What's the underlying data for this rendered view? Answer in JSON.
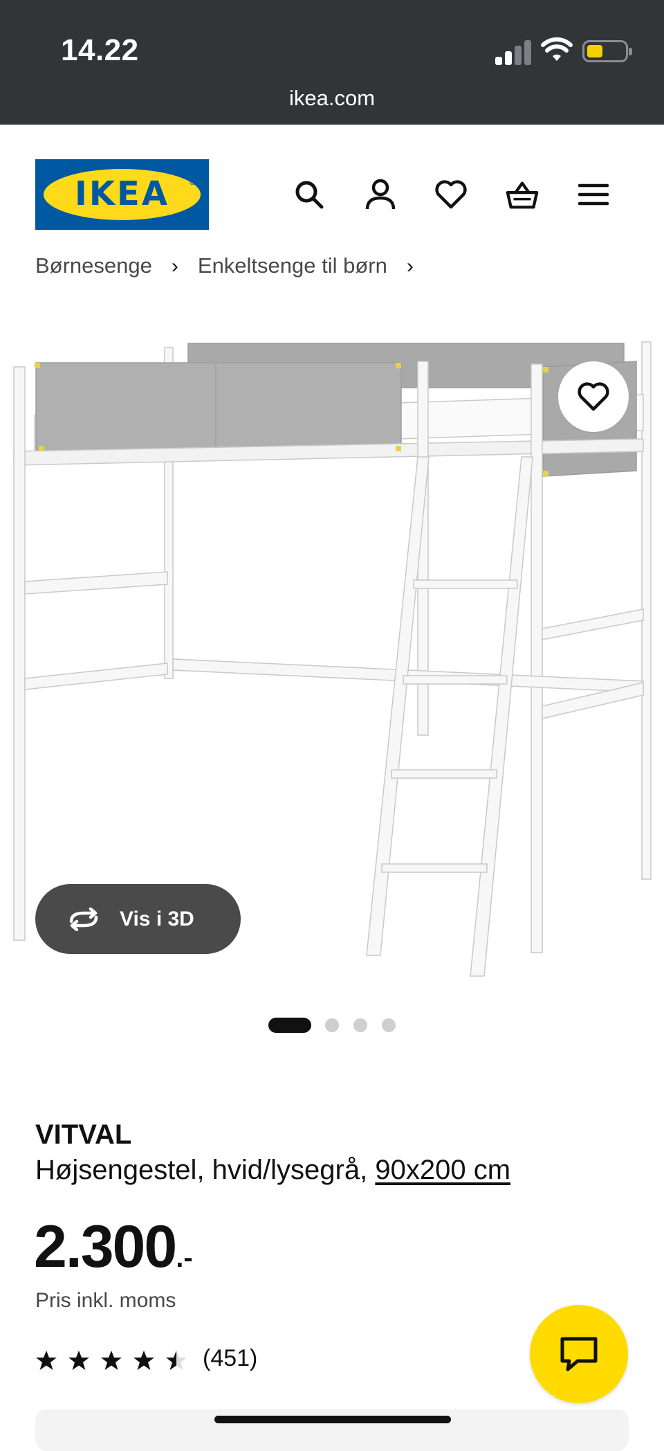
{
  "status_bar": {
    "time": "14.22",
    "url": "ikea.com"
  },
  "header": {
    "logo_text": "IKEA",
    "icons": [
      "search-icon",
      "account-icon",
      "heart-icon",
      "basket-icon",
      "menu-icon"
    ]
  },
  "breadcrumb": {
    "items": [
      "Børnesenge",
      "Enkeltsenge til børn"
    ]
  },
  "gallery": {
    "view_3d_label": "Vis i 3D",
    "image_count": 4,
    "active_image_index": 0
  },
  "product": {
    "name": "VITVAL",
    "description": "Højsengestel, hvid/lysegrå,",
    "size": "90x200 cm",
    "price": "2.300",
    "price_suffix": ".-",
    "vat_note": "Pris inkl. moms",
    "rating": 4.5,
    "rating_max": 5,
    "review_count": "(451)"
  },
  "colors": {
    "ikea_blue": "#0058a3",
    "ikea_yellow": "#ffda1a",
    "chat_yellow": "#ffdb00",
    "status_bar": "#323538"
  }
}
